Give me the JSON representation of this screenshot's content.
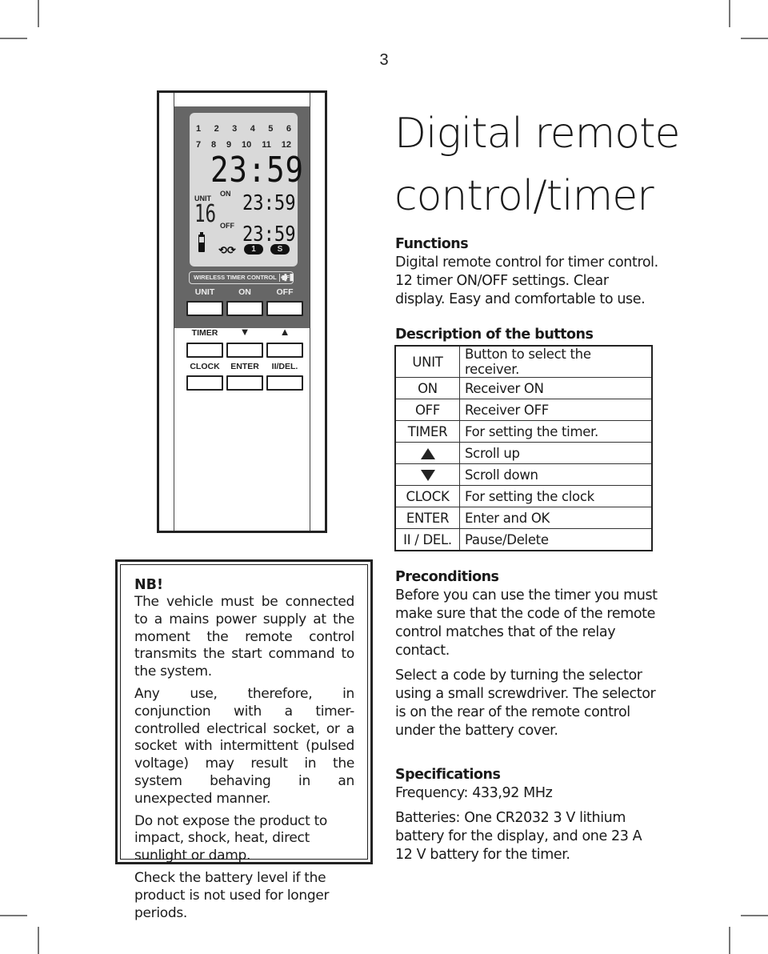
{
  "page_number": "3",
  "title_line1": "Digital remote",
  "title_line2": "control/timer",
  "remote": {
    "lcd": {
      "channels_row1": [
        "1",
        "2",
        "3",
        "4",
        "5",
        "6"
      ],
      "channels_row2": [
        "7",
        "8",
        "9",
        "10",
        "11",
        "12"
      ],
      "clock_time": "23:59",
      "unit_label": "UNIT",
      "unit_number": "16",
      "on_label": "ON",
      "on_time": "23:59",
      "off_label": "OFF",
      "off_time": "23:59",
      "repeat_icon": "repeat-icon",
      "once_badge": "1",
      "s_badge": "S",
      "battery_icon": "battery-icon"
    },
    "rf_badge_text": "WIRELESS TIMER CONTROL",
    "rf_signal_icon": "signal-bars-icon",
    "rf_label": "RF",
    "buttons": [
      {
        "label": "UNIT"
      },
      {
        "label": "ON"
      },
      {
        "label": "OFF"
      },
      {
        "label": "TIMER"
      },
      {
        "label": "▼"
      },
      {
        "label": "▲"
      },
      {
        "label": "CLOCK"
      },
      {
        "label": "ENTER"
      },
      {
        "label": "II/DEL."
      }
    ]
  },
  "functions": {
    "heading": "Functions",
    "text": "Digital remote control for timer control. 12 timer ON/OFF settings. Clear display. Easy and comfortable to use."
  },
  "description": {
    "heading": "Description of the buttons",
    "rows": [
      {
        "key": "UNIT",
        "icon": "",
        "value": "Button to select the receiver."
      },
      {
        "key": "ON",
        "icon": "",
        "value": "Receiver ON"
      },
      {
        "key": "OFF",
        "icon": "",
        "value": "Receiver OFF"
      },
      {
        "key": "TIMER",
        "icon": "",
        "value": "For setting the timer."
      },
      {
        "key": "",
        "icon": "triangle-up-icon",
        "value": "Scroll up"
      },
      {
        "key": "",
        "icon": "triangle-down-icon",
        "value": "Scroll down"
      },
      {
        "key": "CLOCK",
        "icon": "",
        "value": "For setting the clock"
      },
      {
        "key": "ENTER",
        "icon": "",
        "value": "Enter and OK"
      },
      {
        "key": "II / DEL.",
        "icon": "",
        "value": "Pause/Delete"
      }
    ]
  },
  "nb": {
    "title": "NB!",
    "paragraphs": [
      "The vehicle must be connected to a mains power supply at the moment the remote control transmits the start command to the system.",
      "Any use, therefore, in conjunction with a timer-controlled electrical socket, or a socket with intermittent (pulsed voltage) may result in the system behaving in an unexpected manner.",
      "Do not expose the product to impact, shock, heat, direct sunlight or damp.",
      "Check the battery level if the product is not used for longer periods."
    ]
  },
  "preconditions": {
    "heading": "Preconditions",
    "paragraphs": [
      "Before you can use the timer you must make sure that the code of the remote control matches that of the relay contact.",
      "Select a code by turning the selector using a small screwdriver. The selector is on the rear of the remote control under the battery cover."
    ]
  },
  "specifications": {
    "heading": "Specifications",
    "paragraphs": [
      "Frequency: 433,92 MHz",
      "Batteries: One CR2032 3 V lithium battery for the display, and one 23 A 12 V battery for the timer."
    ]
  }
}
